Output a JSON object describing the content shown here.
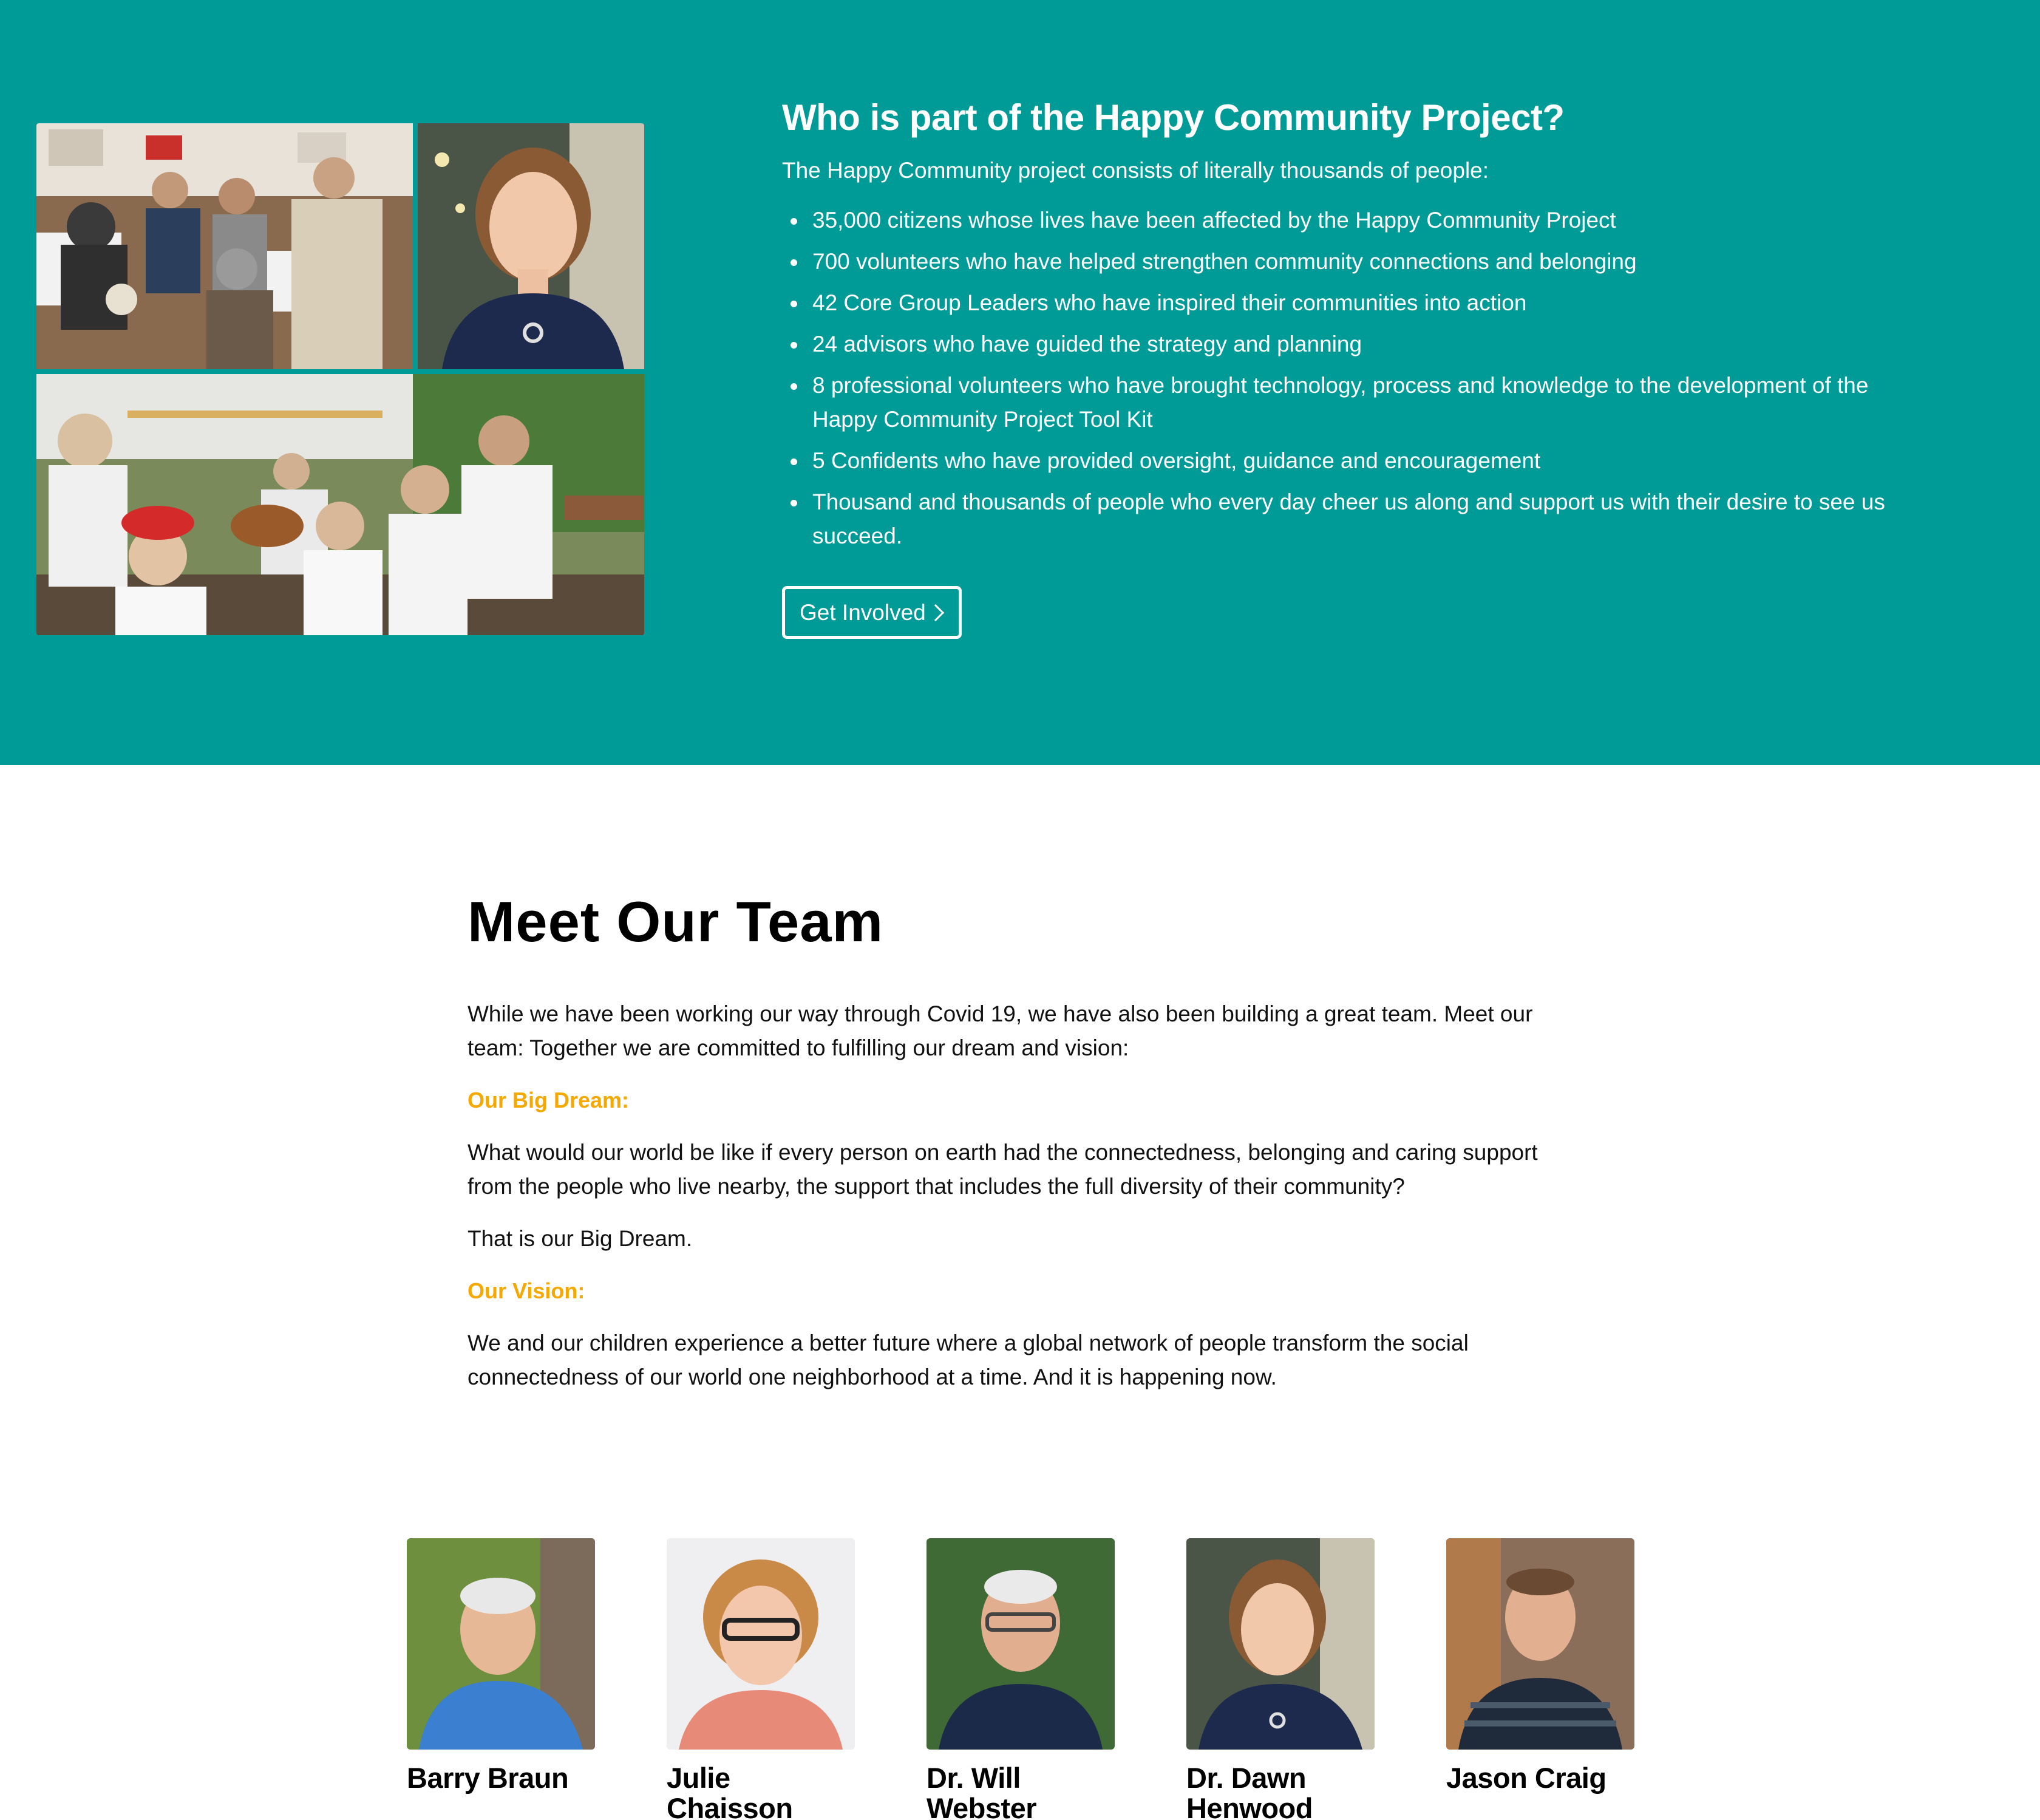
{
  "hero": {
    "title": "Who is part of the Happy Community Project?",
    "intro": "The Happy Community project consists of literally thousands of people:",
    "items": [
      "35,000 citizens whose lives have been affected by the Happy Community Project",
      "700 volunteers who have helped strengthen community connections and belonging",
      "42 Core Group Leaders who have inspired their communities into action",
      "24 advisors who have guided the strategy and planning",
      "8 professional volunteers who have brought technology, process and knowledge to the development of the Happy Community Project Tool Kit",
      "5 Confidents who have provided oversight, guidance and encouragement",
      "Thousand and thousands of people who every day cheer us along and support us with their desire to see us succeed."
    ],
    "button_label": "Get Involved",
    "background_color": "#009b97"
  },
  "team": {
    "title": "Meet Our Team",
    "intro": "While we have been working our way through Covid 19, we have also been building a great team. Meet our team: Together we are committed to fulfilling our dream and vision:",
    "dream_heading": "Our Big Dream:",
    "dream_text": "What would our world be like if every person on earth had the connectedness, belonging and caring support from the people who live nearby, the support that includes the full diversity of their community?",
    "dream_closing": "That is our Big Dream.",
    "vision_heading": "Our Vision:",
    "vision_text": "We and our children experience a better future where a global network of people transform the social connectedness of our world one neighborhood at a time. And it is happening now.",
    "accent_color": "#f5a800",
    "members": [
      {
        "name": "Barry Braun"
      },
      {
        "name": "Julie Chaisson"
      },
      {
        "name": "Dr. Will Webster"
      },
      {
        "name": "Dr. Dawn Henwood"
      },
      {
        "name": "Jason Craig"
      }
    ]
  }
}
